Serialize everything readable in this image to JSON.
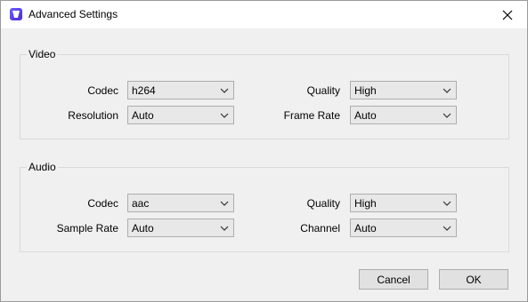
{
  "window": {
    "title": "Advanced Settings",
    "close_icon": "close-icon",
    "app_icon": "app-icon"
  },
  "video": {
    "label": "Video",
    "codec": {
      "label": "Codec",
      "value": "h264"
    },
    "resolution": {
      "label": "Resolution",
      "value": "Auto"
    },
    "quality": {
      "label": "Quality",
      "value": "High"
    },
    "frame_rate": {
      "label": "Frame Rate",
      "value": "Auto"
    }
  },
  "audio": {
    "label": "Audio",
    "codec": {
      "label": "Codec",
      "value": "aac"
    },
    "sample_rate": {
      "label": "Sample Rate",
      "value": "Auto"
    },
    "quality": {
      "label": "Quality",
      "value": "High"
    },
    "channel": {
      "label": "Channel",
      "value": "Auto"
    }
  },
  "buttons": {
    "cancel": "Cancel",
    "ok": "OK"
  }
}
